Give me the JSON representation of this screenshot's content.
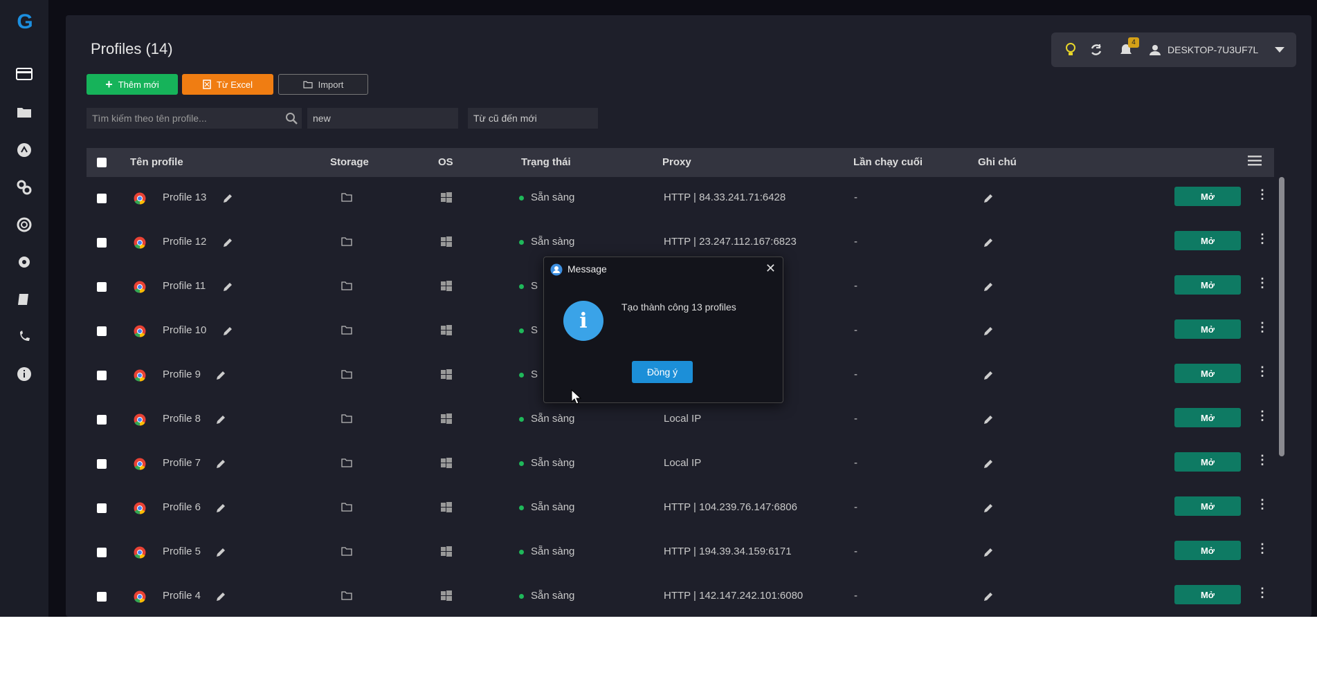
{
  "header": {
    "title": "Profiles (14)",
    "user": "DESKTOP-7U3UF7L",
    "notification_count": "4"
  },
  "toolbar": {
    "add_label": "Thêm mới",
    "excel_label": "Từ Excel",
    "import_label": "Import"
  },
  "filters": {
    "search_placeholder": "Tìm kiếm theo tên profile...",
    "group_value": "new",
    "sort_value": "Từ cũ đến mới"
  },
  "table": {
    "columns": [
      "Tên profile",
      "Storage",
      "OS",
      "Trạng thái",
      "Proxy",
      "Lần chạy cuối",
      "Ghi chú"
    ],
    "rows": [
      {
        "name": "Profile 13",
        "status": "Sẵn sàng",
        "proxy": "HTTP | 84.33.241.71:6428",
        "last_run": "-",
        "open": "Mở"
      },
      {
        "name": "Profile 12",
        "status": "Sẵn sàng",
        "proxy": "HTTP | 23.247.112.167:6823",
        "last_run": "-",
        "open": "Mở"
      },
      {
        "name": "Profile 11",
        "status": "S",
        "proxy": "35",
        "last_run": "-",
        "open": "Mở"
      },
      {
        "name": "Profile 10",
        "status": "S",
        "proxy": "093",
        "last_run": "-",
        "open": "Mở"
      },
      {
        "name": "Profile 9",
        "status": "S",
        "proxy": "6126",
        "last_run": "-",
        "open": "Mở"
      },
      {
        "name": "Profile 8",
        "status": "Sẵn sàng",
        "proxy": "Local IP",
        "last_run": "-",
        "open": "Mở"
      },
      {
        "name": "Profile 7",
        "status": "Sẵn sàng",
        "proxy": "Local IP",
        "last_run": "-",
        "open": "Mở"
      },
      {
        "name": "Profile 6",
        "status": "Sẵn sàng",
        "proxy": "HTTP | 104.239.76.147:6806",
        "last_run": "-",
        "open": "Mở"
      },
      {
        "name": "Profile 5",
        "status": "Sẵn sàng",
        "proxy": "HTTP | 194.39.34.159:6171",
        "last_run": "-",
        "open": "Mở"
      },
      {
        "name": "Profile 4",
        "status": "Sẵn sàng",
        "proxy": "HTTP | 142.147.242.101:6080",
        "last_run": "-",
        "open": "Mở"
      }
    ]
  },
  "dialog": {
    "title": "Message",
    "message": "Tạo thành công 13 profiles",
    "ok_label": "Đồng ý"
  },
  "colors": {
    "accent_green": "#16b35a",
    "excel_orange": "#f07d12",
    "open_button": "#0e7a63",
    "dialog_button": "#1c8fd8"
  }
}
